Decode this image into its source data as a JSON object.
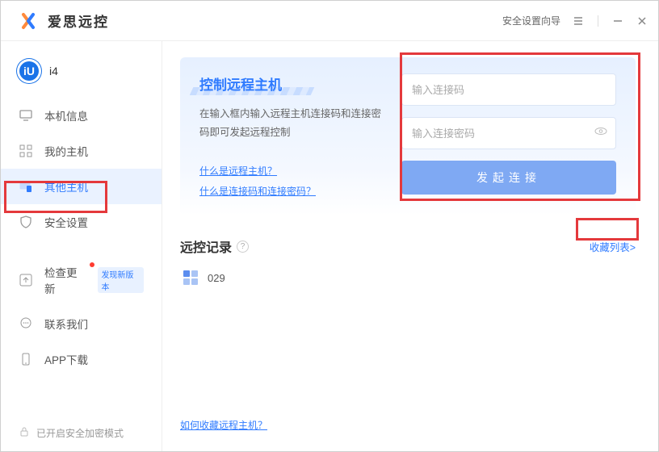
{
  "titlebar": {
    "app_name": "爱思远控",
    "security_wizard": "安全设置向导"
  },
  "user": {
    "avatar_label": "iU",
    "name": "i4"
  },
  "sidebar": {
    "items": [
      {
        "id": "local-info",
        "label": "本机信息"
      },
      {
        "id": "my-hosts",
        "label": "我的主机"
      },
      {
        "id": "other-hosts",
        "label": "其他主机"
      },
      {
        "id": "security",
        "label": "安全设置"
      },
      {
        "id": "check-update",
        "label": "检查更新",
        "tag": "发现新版本",
        "dot": true
      },
      {
        "id": "contact-us",
        "label": "联系我们"
      },
      {
        "id": "app-download",
        "label": "APP下载"
      }
    ],
    "secure_mode": "已开启安全加密模式"
  },
  "card": {
    "title": "控制远程主机",
    "desc": "在输入框内输入远程主机连接码和连接密码即可发起远程控制",
    "link_what_host": "什么是远程主机？",
    "link_what_code": "什么是连接码和连接密码？",
    "input_code_placeholder": "输入连接码",
    "input_pwd_placeholder": "输入连接密码",
    "connect_btn": "发起连接"
  },
  "history": {
    "title": "远控记录",
    "fav_link": "收藏列表>",
    "items": [
      {
        "code": "029"
      }
    ]
  },
  "footer": {
    "how_to_fav": "如何收藏远程主机？"
  }
}
